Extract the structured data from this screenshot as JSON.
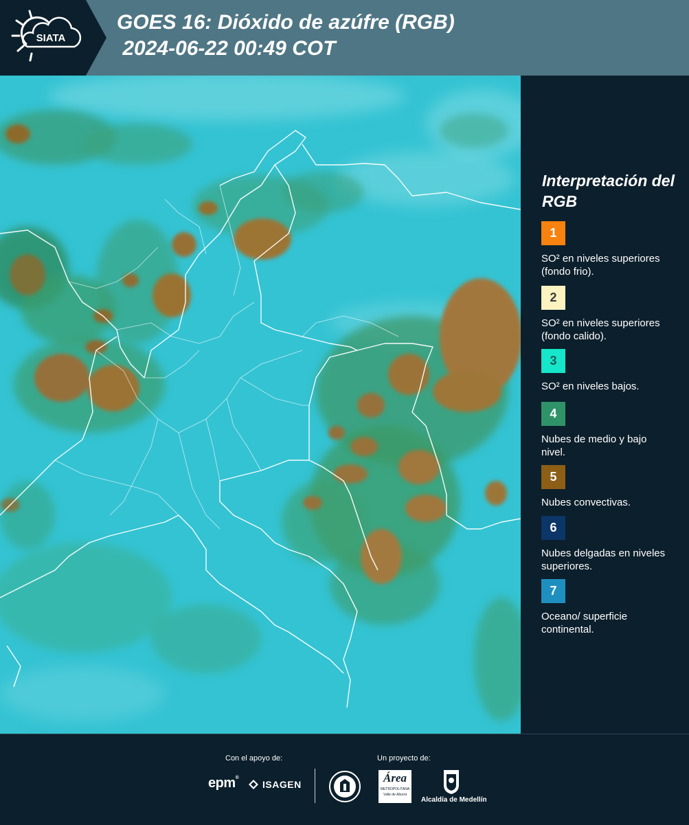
{
  "header": {
    "logo_text": "SIATA",
    "title": "GOES 16: Dióxido de azúfre (RGB)\n 2024-06-22 00:49 COT"
  },
  "legend": {
    "title": "Interpretación del RGB",
    "items": [
      {
        "number": "1",
        "color": "#f7820f",
        "num_color": "#ffffff",
        "text": "SO² en niveles superiores (fondo frio)."
      },
      {
        "number": "2",
        "color": "#fcf3c0",
        "num_color": "#3a3a3a",
        "text": "SO² en niveles superiores (fondo calido)."
      },
      {
        "number": "3",
        "color": "#16e6c9",
        "num_color": "#1d5a5a",
        "text": "SO² en niveles bajos."
      },
      {
        "number": "4",
        "color": "#2f9369",
        "num_color": "#ffffff",
        "text": "Nubes de medio y bajo nivel."
      },
      {
        "number": "5",
        "color": "#8c5e16",
        "num_color": "#ffffff",
        "text": "Nubes convectivas."
      },
      {
        "number": "6",
        "color": "#0c3568",
        "num_color": "#ffffff",
        "text": "Nubes delgadas en niveles superiores."
      },
      {
        "number": "7",
        "color": "#1f8fc0",
        "num_color": "#ffffff",
        "text": "Oceano/ superficie continental."
      }
    ]
  },
  "footer": {
    "support_label": "Con el apoyo de:",
    "project_label": "Un proyecto de:",
    "sponsor_epm": "epm",
    "sponsor_isagen": "ISAGEN",
    "partner_area": "Área",
    "partner_area_sub": "METROPOLITANA",
    "partner_area_sub2": "Valle de Aburrá",
    "partner_alcaldia": "Alcaldía de Medellín"
  }
}
